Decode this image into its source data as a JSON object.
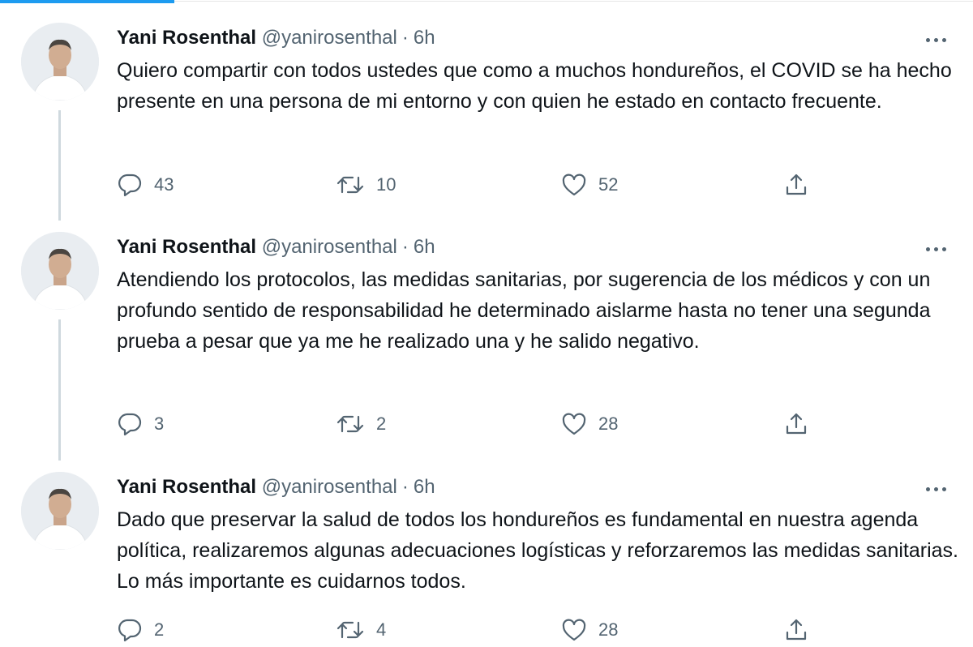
{
  "tweets": [
    {
      "name": "Yani Rosenthal",
      "handle": "@yanirosenthal",
      "separator": "·",
      "time": "6h",
      "text": "Quiero compartir con todos ustedes que como a muchos hondureños, el COVID se ha hecho presente en una persona de mi entorno y con quien he estado en contacto frecuente.",
      "replies": "43",
      "retweets": "10",
      "likes": "52"
    },
    {
      "name": "Yani Rosenthal",
      "handle": "@yanirosenthal",
      "separator": "·",
      "time": "6h",
      "text": "Atendiendo los protocolos, las medidas sanitarias, por sugerencia de los médicos y con un profundo sentido de responsabilidad he determinado aislarme hasta no tener una segunda prueba a pesar que ya me he realizado una y he salido negativo.",
      "replies": "3",
      "retweets": "2",
      "likes": "28"
    },
    {
      "name": "Yani Rosenthal",
      "handle": "@yanirosenthal",
      "separator": "·",
      "time": "6h",
      "text": "Dado que preservar la salud de todos los hondureños es fundamental en nuestra agenda política, realizaremos algunas adecuaciones logísticas y reforzaremos las medidas sanitarias. Lo más importante es cuidarnos todos.",
      "replies": "2",
      "retweets": "4",
      "likes": "28"
    }
  ],
  "icons": {
    "reply": "reply-icon",
    "retweet": "retweet-icon",
    "like": "heart-icon",
    "share": "share-icon",
    "more": "more-icon"
  },
  "colors": {
    "accent": "#1d9bf0",
    "text": "#0f1419",
    "secondary": "#536471",
    "thread_line": "#cfd9de"
  }
}
